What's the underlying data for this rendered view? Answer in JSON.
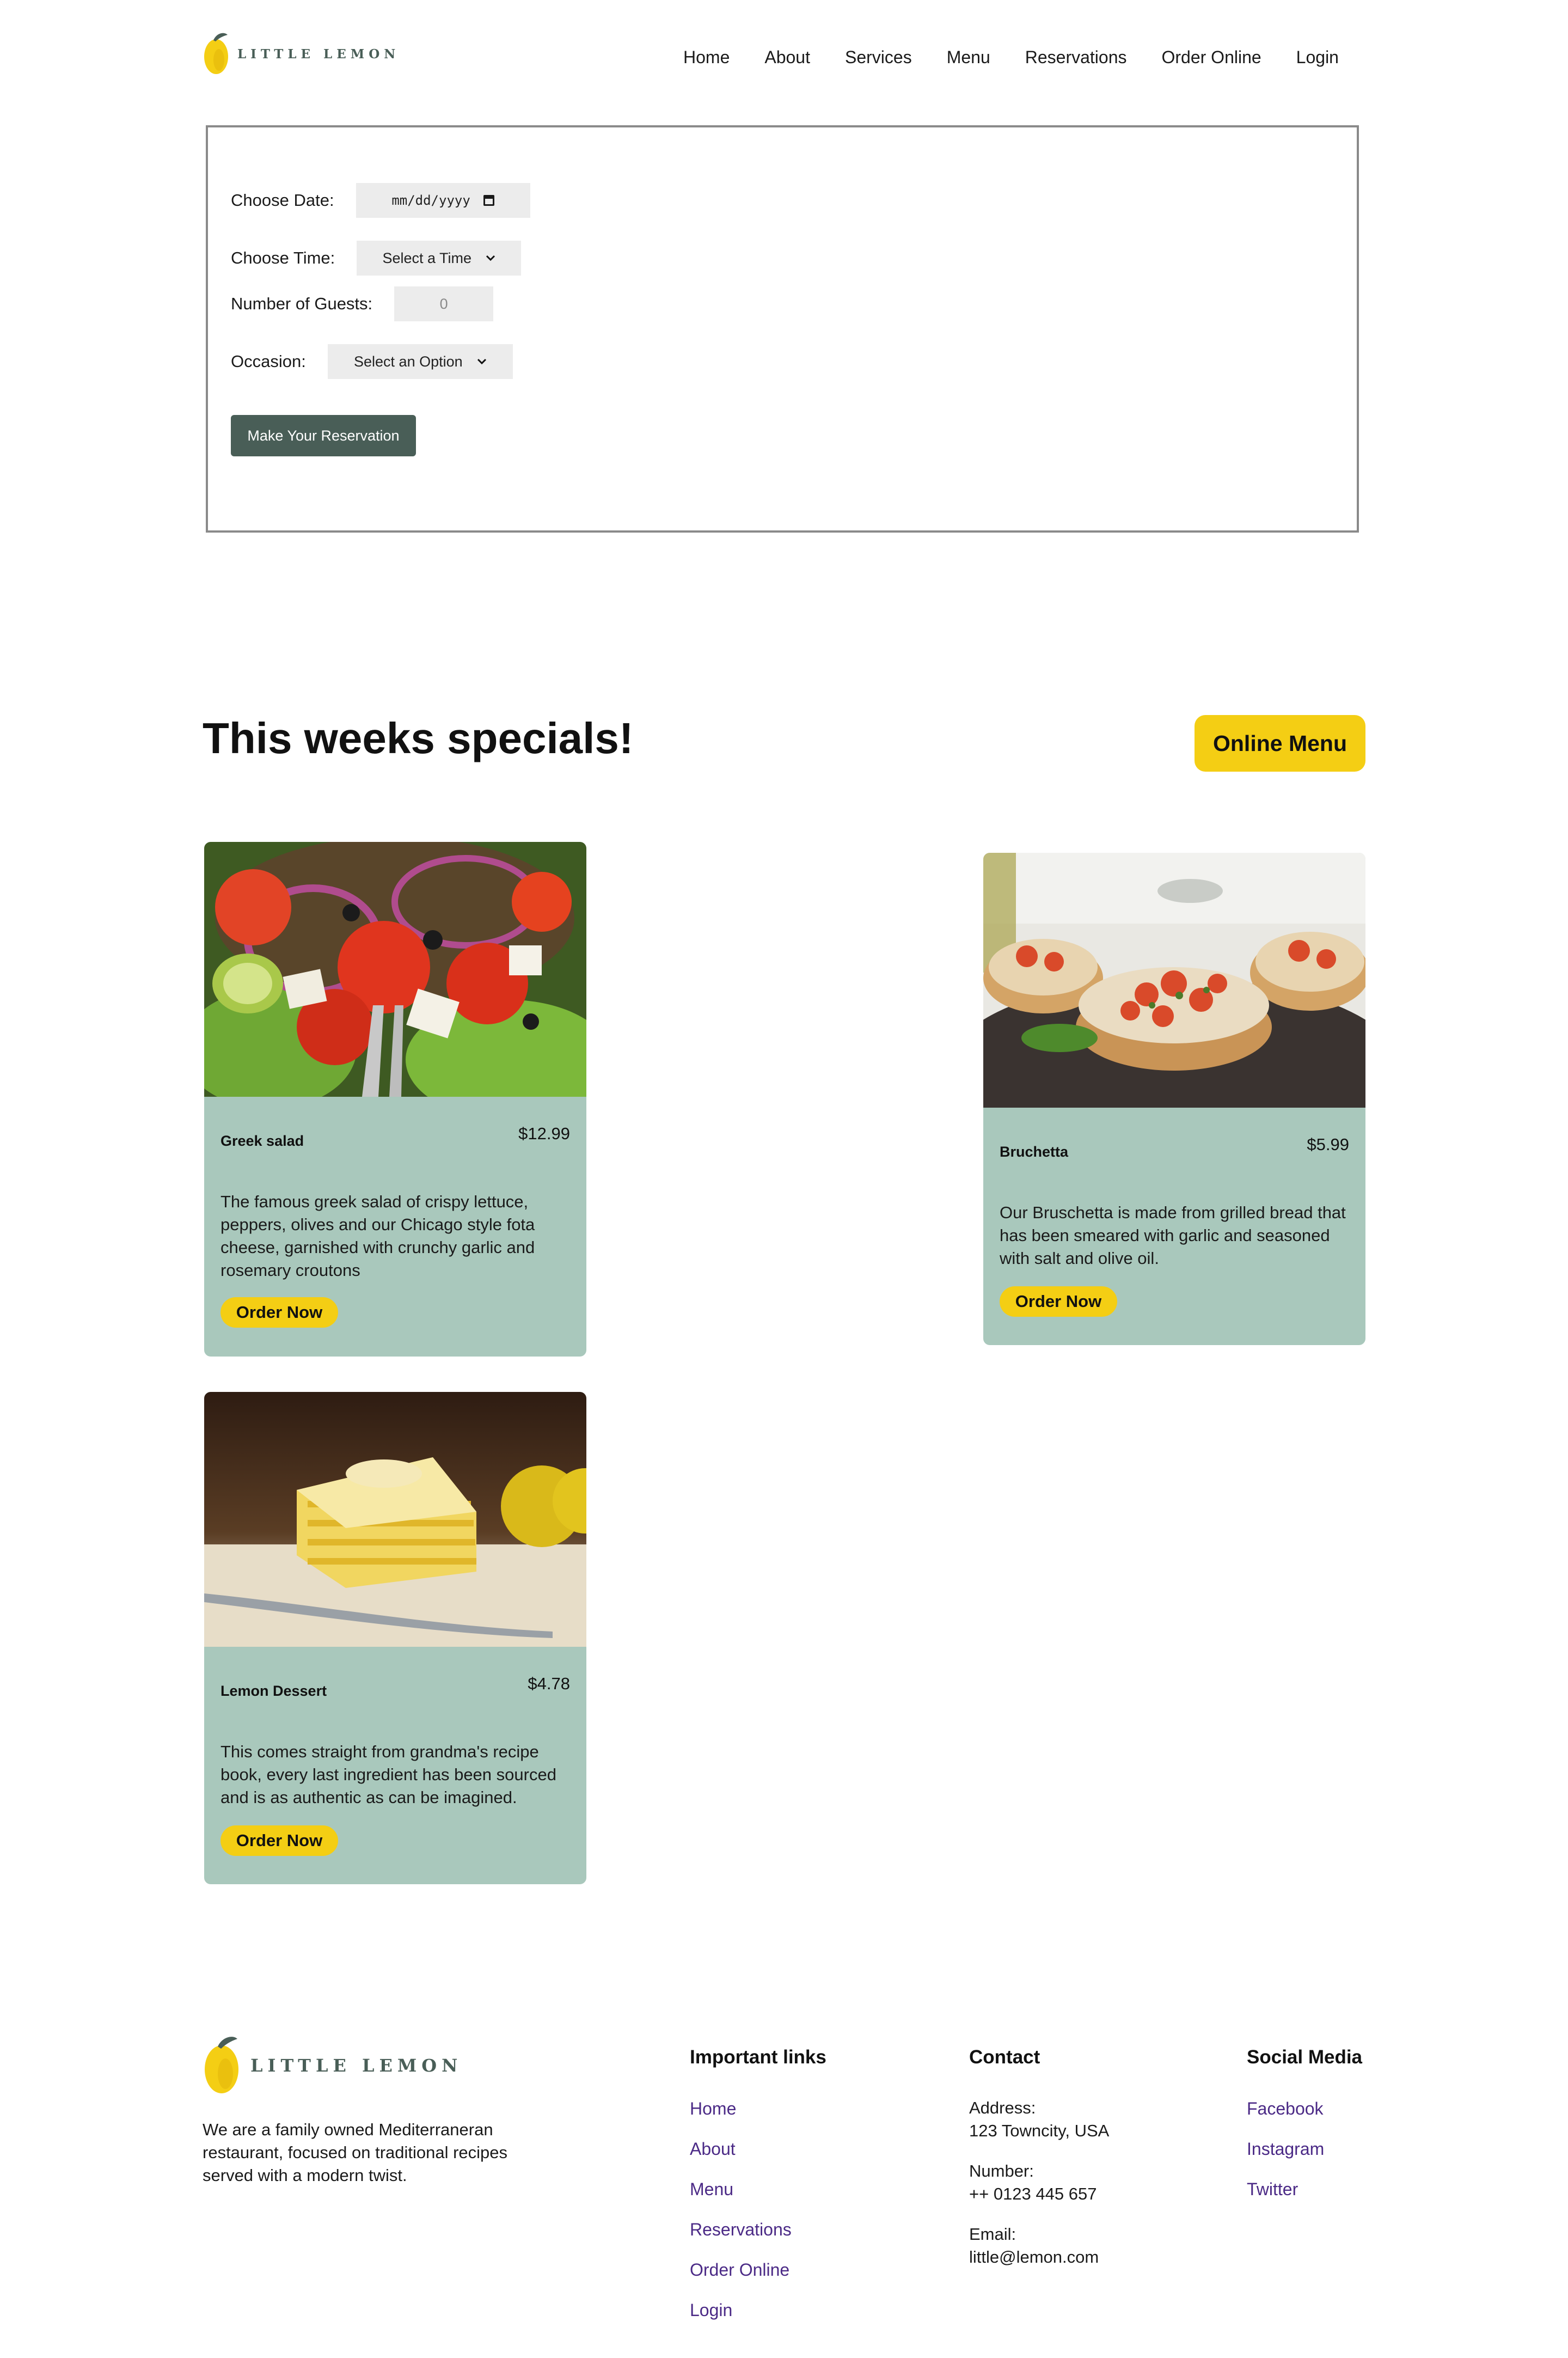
{
  "header": {
    "logo_text": "LITTLE LEMON",
    "nav": [
      "Home",
      "About",
      "Services",
      "Menu",
      "Reservations",
      "Order Online",
      "Login"
    ]
  },
  "reservation_form": {
    "date_label": "Choose Date:",
    "date_value": "mm/dd/yyyy",
    "time_label": "Choose Time:",
    "time_value": "Select a Time",
    "guests_label": "Number of Guests:",
    "guests_value": "0",
    "occasion_label": "Occasion:",
    "occasion_value": "Select an Option",
    "submit_label": "Make Your Reservation"
  },
  "specials": {
    "title": "This weeks specials!",
    "online_menu_label": "Online Menu",
    "cards": [
      {
        "name": "Greek salad",
        "price": "$12.99",
        "description": "The famous greek salad of crispy lettuce, peppers, olives and our Chicago style fota cheese, garnished with crunchy garlic and rosemary croutons",
        "button": "Order Now"
      },
      {
        "name": "Bruchetta",
        "price": "$5.99",
        "description": "Our Bruschetta is made from grilled bread that has been smeared with garlic and seasoned with salt and olive oil.",
        "button": "Order Now"
      },
      {
        "name": "Lemon Dessert",
        "price": "$4.78",
        "description": "This comes straight from grandma's recipe book, every last ingredient has been sourced and is as authentic as can be imagined.",
        "button": "Order Now"
      }
    ]
  },
  "footer": {
    "logo_text": "LITTLE LEMON",
    "about": "We are a family owned Mediterraneran restaurant, focused on traditional recipes served with a modern twist.",
    "links_title": "Important links",
    "links": [
      "Home",
      "About",
      "Menu",
      "Reservations",
      "Order Online",
      "Login"
    ],
    "contact_title": "Contact",
    "contact": {
      "address_label": "Address:",
      "address": "123 Towncity, USA",
      "number_label": "Number:",
      "number": "++ 0123 445 657",
      "email_label": "Email:",
      "email": "little@lemon.com"
    },
    "social_title": "Social Media",
    "social": [
      "Facebook",
      "Instagram",
      "Twitter"
    ]
  },
  "colors": {
    "brand_green": "#495e57",
    "brand_yellow": "#f4ce14",
    "card_bg": "#a9c8bc",
    "link_purple": "#4b2a86"
  }
}
